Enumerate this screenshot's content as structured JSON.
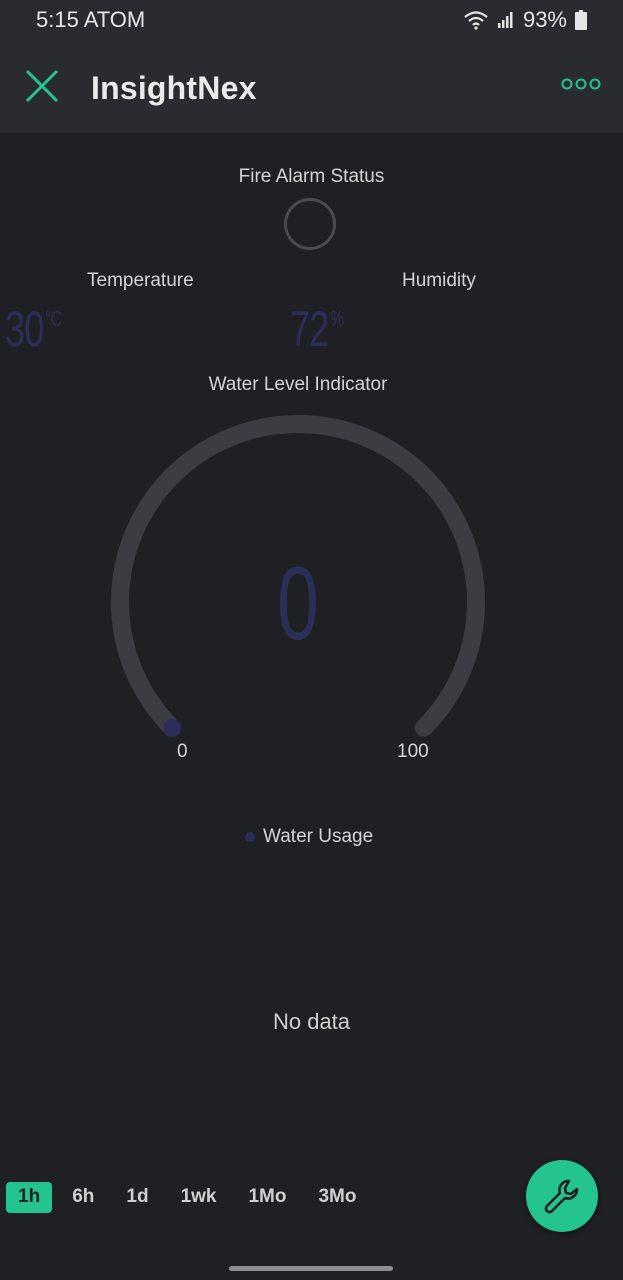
{
  "status_bar": {
    "time": "5:15 ATOM",
    "battery": "93%"
  },
  "app": {
    "title": "InsightNex"
  },
  "fire_alarm": {
    "title": "Fire Alarm Status"
  },
  "temperature": {
    "label": "Temperature",
    "value": "30",
    "unit": "°C"
  },
  "humidity": {
    "label": "Humidity",
    "value": "72",
    "unit": "%"
  },
  "water_level": {
    "title": "Water Level Indicator",
    "value": "0",
    "min": "0",
    "max": "100",
    "level": 0
  },
  "water_usage": {
    "legend": "Water Usage",
    "empty_text": "No data"
  },
  "time_ranges": [
    {
      "label": "1h",
      "active": true
    },
    {
      "label": "6h",
      "active": false
    },
    {
      "label": "1d",
      "active": false
    },
    {
      "label": "1wk",
      "active": false
    },
    {
      "label": "1Mo",
      "active": false
    },
    {
      "label": "3Mo",
      "active": false
    }
  ],
  "colors": {
    "accent": "#23c48e",
    "widget_value": "#2c2e5a",
    "background": "#1f2024",
    "panel": "#2a2b30"
  },
  "icons": {
    "close": "close-icon",
    "more": "more-dots-icon",
    "fab": "wrench-icon"
  }
}
